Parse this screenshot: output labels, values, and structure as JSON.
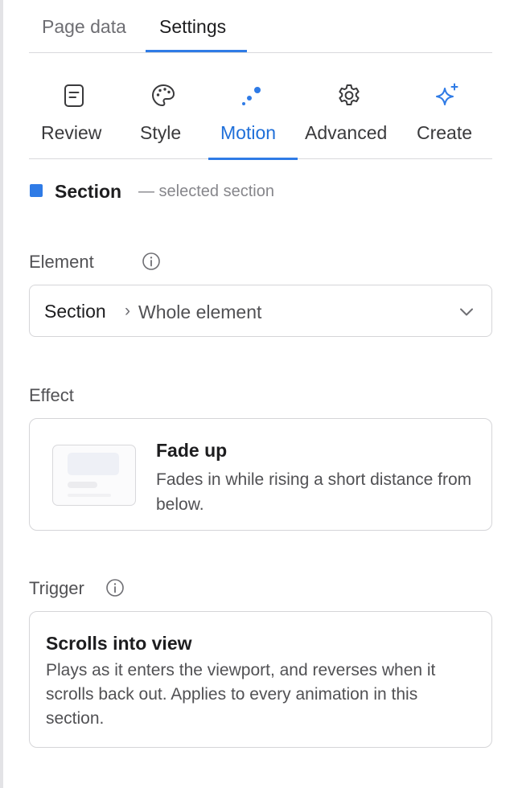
{
  "top_tabs": [
    {
      "label": "Page data",
      "active": false
    },
    {
      "label": "Settings",
      "active": true
    }
  ],
  "icon_tabs": [
    {
      "label": "Review",
      "icon": "document-icon",
      "active": false
    },
    {
      "label": "Style",
      "icon": "palette-icon",
      "active": false
    },
    {
      "label": "Motion",
      "icon": "motion-dots-icon",
      "active": true
    },
    {
      "label": "Advanced",
      "icon": "gear-icon",
      "active": false
    },
    {
      "label": "Create",
      "icon": "sparkle-icon",
      "active": false
    }
  ],
  "selection": {
    "name": "Section",
    "description": "— selected section"
  },
  "element": {
    "label": "Element",
    "selected_main": "Section",
    "separator": "›",
    "selected_sub": "Whole element"
  },
  "effect": {
    "label": "Effect",
    "title": "Fade up",
    "description": "Fades in while rising a short distance from below."
  },
  "trigger": {
    "label": "Trigger",
    "title": "Scrolls into view",
    "description": "Plays as it enters the viewport, and reverses when it scrolls back out. Applies to every animation in this section."
  },
  "colors": {
    "accent": "#2f7be6",
    "active_tab_text": "#1f6fd9",
    "border": "#d5d5d8"
  }
}
